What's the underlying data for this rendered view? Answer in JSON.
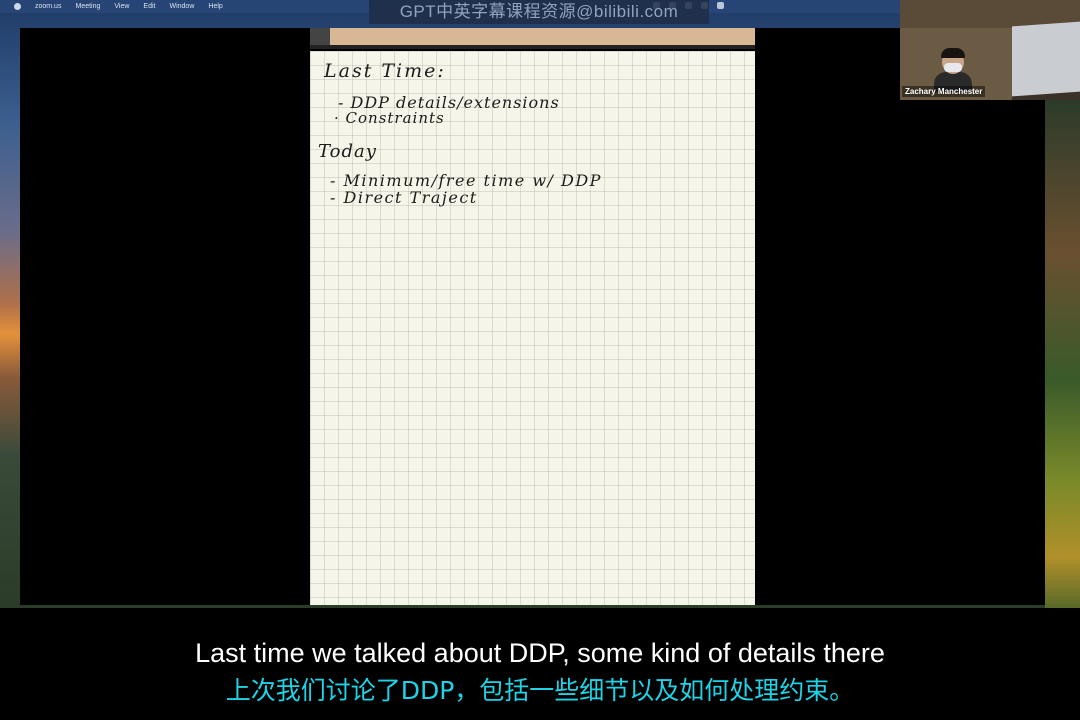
{
  "menubar": {
    "items": [
      "zoom.us",
      "Meeting",
      "View",
      "Edit",
      "Window",
      "Help"
    ]
  },
  "watermark": "GPT中英字幕课程资源@bilibili.com",
  "notes": {
    "last_time_heading": "Last Time:",
    "last_time_items": [
      "- DDP details/extensions",
      "· Constraints"
    ],
    "today_heading": "Today",
    "today_items": [
      "- Minimum/free time w/ DDP",
      "- Direct Traject"
    ]
  },
  "webcam": {
    "participant_name": "Zachary Manchester"
  },
  "subtitles": {
    "english": "Last time we talked about DDP, some kind of details there",
    "chinese": "上次我们讨论了DDP，包括一些细节以及如何处理约束。"
  },
  "colors": {
    "subtitle_chinese": "#1fd3e6",
    "subtitle_english": "#ffffff",
    "paper": "#f6f5e9"
  }
}
